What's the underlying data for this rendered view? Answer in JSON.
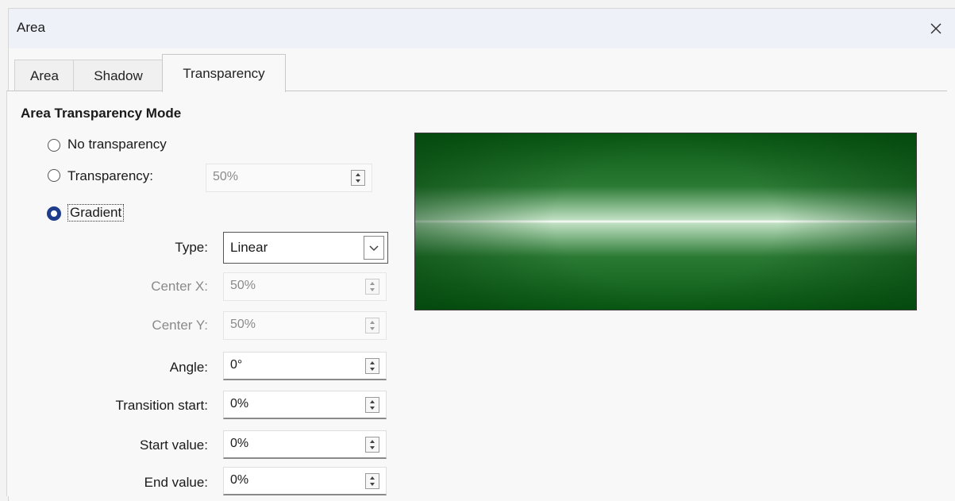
{
  "window": {
    "title": "Area",
    "close_icon": "close-icon"
  },
  "tabs": [
    {
      "label": "Area",
      "active": false
    },
    {
      "label": "Shadow",
      "active": false
    },
    {
      "label": "Transparency",
      "active": true
    }
  ],
  "section": {
    "title": "Area Transparency Mode"
  },
  "modes": {
    "no_transparency": {
      "label": "No transparency",
      "selected": false
    },
    "transparency": {
      "label": "Transparency:",
      "selected": false,
      "value": "50%"
    },
    "gradient": {
      "label": "Gradient",
      "selected": true
    }
  },
  "gradient": {
    "type_label": "Type:",
    "type_value": "Linear",
    "center_x_label": "Center X:",
    "center_x_value": "50%",
    "center_y_label": "Center Y:",
    "center_y_value": "50%",
    "angle_label": "Angle:",
    "angle_value": "0°",
    "transition_start_label": "Transition start:",
    "transition_start_value": "0%",
    "start_value_label": "Start value:",
    "start_value_value": "0%",
    "end_value_label": "End value:",
    "end_value_value": "0%"
  },
  "preview": {
    "colors": [
      "#0a5a14",
      "#ffffff"
    ]
  },
  "colors": {
    "accent": "#1f3d8c",
    "titlebar": "#eef2f8"
  }
}
